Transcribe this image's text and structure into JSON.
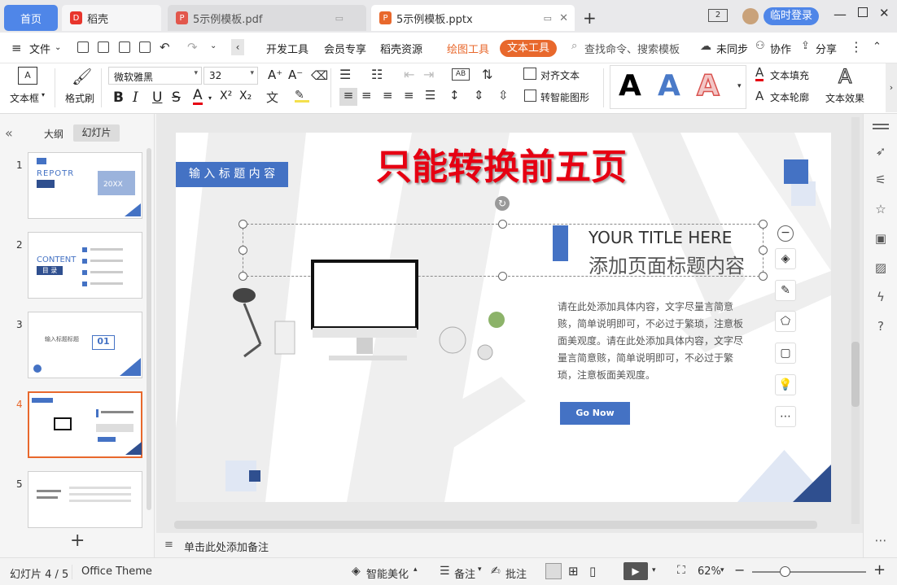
{
  "tabs": {
    "home": "首页",
    "daoke": "稻壳",
    "pdf": "5示例模板.pdf",
    "pptx": "5示例模板.pptx",
    "login": "临时登录"
  },
  "menu": {
    "file": "文件",
    "dev_tools": "开发工具",
    "member": "会员专享",
    "daoke_res": "稻壳资源",
    "draw_tools": "绘图工具",
    "text_tools": "文本工具",
    "search": "查找命令、搜索模板",
    "unsync": "未同步",
    "collab": "协作",
    "share": "分享"
  },
  "toolbar": {
    "textbox": "文本框",
    "format_brush": "格式刷",
    "font_name": "微软雅黑",
    "font_size": "32",
    "align_text": "对齐文本",
    "smart_shape": "转智能图形",
    "text_fill": "文本填充",
    "text_outline": "文本轮廓",
    "text_effect": "文本效果",
    "style_letter": "A",
    "bold": "B",
    "italic": "I",
    "underline": "U",
    "strike": "S",
    "fontcolor": "A",
    "superscript": "X²",
    "subscript": "X₂",
    "grow": "A⁺",
    "shrink": "A⁻"
  },
  "left_panel": {
    "outline_tab": "大纲",
    "slides_tab": "幻灯片",
    "slide_numbers": [
      "1",
      "2",
      "3",
      "4",
      "5"
    ],
    "thumb1_title": "REPOTR",
    "thumb1_badge": "20XX",
    "thumb2_title": "CONTENT",
    "thumb2_sub": "目 录",
    "thumb3_num": "01",
    "thumb3_title": "输入标题标题"
  },
  "slide": {
    "overlay_text": "只能转换前五页",
    "header_box": "输 入 标 题 内 容",
    "title_en": "YOUR TITLE HERE",
    "title_cn": "添加页面标题内容",
    "body": "请在此处添加具体内容，文字尽量言简意赅，简单说明即可，不必过于繁琐，注意板面美观度。请在此处添加具体内容，文字尽量言简意赅，简单说明即可，不必过于繁琐，注意板面美观度。",
    "button": "Go Now"
  },
  "notes": {
    "placeholder": "单击此处添加备注"
  },
  "status": {
    "slide_info": "幻灯片 4 / 5",
    "theme": "Office Theme",
    "beautify": "智能美化",
    "notes": "备注",
    "comment": "批注",
    "zoom": "62%"
  },
  "colors": {
    "accent_blue": "#4472c4",
    "wps_orange": "#e8682c",
    "tab_blue": "#4f86e8",
    "overlay_red": "#e60012"
  }
}
